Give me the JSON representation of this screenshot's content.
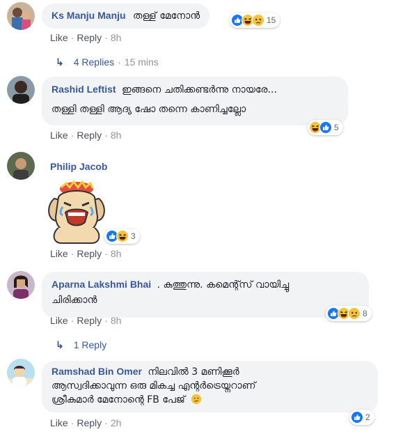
{
  "comments": [
    {
      "author": "Ks Manju Manju",
      "text": "തള്ള് മേനോൻ",
      "reactions_count": "15",
      "actions": {
        "like": "Like",
        "reply": "Reply",
        "time": "8h"
      },
      "replies": {
        "label": "4 Replies",
        "time": "15 mins"
      }
    },
    {
      "author": "Rashid Leftist",
      "text_line1": "ഇങ്ങനെ ചതിക്കണ്ടർന്നു നായരേ...",
      "text_line2": "തള്ളി തള്ളി ആദ്യ ഷോ തന്നെ കാണിച്ചല്ലോ",
      "reactions_count": "5",
      "actions": {
        "like": "Like",
        "reply": "Reply",
        "time": "8h"
      }
    },
    {
      "author": "Philip Jacob",
      "sticker": "crying-dog-sticker",
      "reactions_count": "3",
      "actions": {
        "like": "Like",
        "reply": "Reply",
        "time": "8h"
      }
    },
    {
      "author": "Aparna Lakshmi Bhai",
      "text_line1": ". കുത്തുന്നു. കമെന്റ്സ് വായിച്ചു",
      "text_line2": "ചിരിക്കാൻ",
      "reactions_count": "8",
      "actions": {
        "like": "Like",
        "reply": "Reply",
        "time": "8h"
      },
      "replies": {
        "label": "1 Reply"
      }
    },
    {
      "author": "Ramshad Bin Omer",
      "text_line1": "നിലവിൽ 3 മണിക്കൂർ",
      "text_line2": "ആസ്വദിക്കാവുന്ന ഒരു മികച്ച എന്റർട്രെയ്നറാണ്",
      "text_line3": "ശ്രീകുമാർ മേനോന്റെ FB പേജ്",
      "reactions_count": "2",
      "actions": {
        "like": "Like",
        "reply": "Reply",
        "time": "2h"
      }
    }
  ],
  "colors": {
    "author": "#385898",
    "bubble": "#f2f3f5",
    "like_blue": "#1877f2",
    "meta": "#90949c"
  },
  "icons": {
    "like": "like-icon",
    "haha": "haha-icon",
    "sad": "sad-icon",
    "reply_arrow": "reply-arrow-icon",
    "confused": "confused-emoji-icon"
  }
}
